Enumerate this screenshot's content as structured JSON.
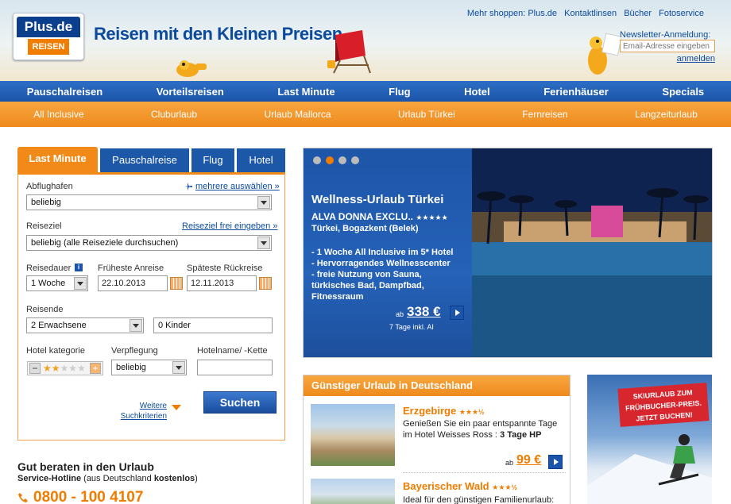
{
  "header": {
    "logo_top": "Plus.de",
    "logo_bottom": "REISEN",
    "slogan": "Reisen mit den Kleinen Preisen",
    "top_links": [
      "Mehr shoppen: Plus.de",
      "Kontaktlinsen",
      "Bücher",
      "Fotoservice"
    ],
    "newsletter": {
      "label": "Newsletter-Anmeldung:",
      "placeholder": "Email-Adresse eingeben",
      "submit": "anmelden"
    }
  },
  "nav_main": [
    "Pauschalreisen",
    "Vorteilsreisen",
    "Last Minute",
    "Flug",
    "Hotel",
    "Ferienhäuser",
    "Specials"
  ],
  "nav_sub": [
    "All Inclusive",
    "Cluburlaub",
    "Urlaub Mallorca",
    "Urlaub Türkei",
    "Fernreisen",
    "Langzeiturlaub"
  ],
  "search": {
    "tabs": [
      "Last Minute",
      "Pauschalreise",
      "Flug",
      "Hotel"
    ],
    "departure_label": "Abflughafen",
    "departure_more": "mehrere auswählen »",
    "departure_value": "beliebig",
    "destination_label": "Reiseziel",
    "destination_free": "Reiseziel frei eingeben »",
    "destination_value": "beliebig (alle Reiseziele durchsuchen)",
    "duration_label": "Reisedauer",
    "duration_value": "1 Woche",
    "earliest_label": "Früheste Anreise",
    "earliest_value": "22.10.2013",
    "latest_label": "Späteste Rückreise",
    "latest_value": "12.11.2013",
    "travelers_label": "Reisende",
    "adults_value": "2 Erwachsene",
    "children_value": "0 Kinder",
    "hotel_cat_label": "Hotel kategorie",
    "hotel_cat_stars": 2,
    "board_label": "Verpflegung",
    "board_value": "beliebig",
    "hotel_name_label": "Hotelname/ -Kette",
    "more_criteria_1": "Weitere",
    "more_criteria_2": "Suchkriterien",
    "submit": "Suchen"
  },
  "hotline": {
    "title": "Gut beraten in den Urlaub",
    "sub_prefix": "Service-Hotline",
    "sub_mid": " (aus Deutschland ",
    "sub_bold": "kostenlos",
    "sub_end": ")",
    "phone": "0800 - 100 4107"
  },
  "hero": {
    "active_dot": 2,
    "dot_count": 4,
    "title": "Wellness-Urlaub Türkei",
    "hotel": "ALVA DONNA EXCLU..",
    "hotel_stars": 5,
    "location": "Türkei, Bogazkent (Belek)",
    "bullets": [
      "- 1 Woche All Inclusive im 5* Hotel",
      "- Hervorragendes Wellnesscenter",
      "- freie Nutzung von Sauna, türkisches    Bad, Dampfbad, Fitnessraum"
    ],
    "price_prefix": "ab",
    "price": "338 €",
    "price_note": "7 Tage inkl. AI"
  },
  "germany": {
    "heading": "Günstiger Urlaub in Deutschland",
    "items": [
      {
        "title": "Erzgebirge",
        "stars": 3.5,
        "text_1": "Genießen Sie ein paar entspannte Tage im Hotel Weisses Ross : ",
        "text_bold": "3 Tage HP",
        "price_prefix": "ab",
        "price": "99 €"
      },
      {
        "title": "Bayerischer Wald",
        "stars": 3.5,
        "text_1": "Ideal für den günstigen Familienurlaub:"
      }
    ]
  },
  "ad": {
    "badge": "SKIURLAUB ZUM FRÜHBUCHER-PREIS. JETZT BUCHEN!"
  },
  "colors": {
    "brand_blue": "#1b54a8",
    "brand_orange": "#f07c00"
  }
}
